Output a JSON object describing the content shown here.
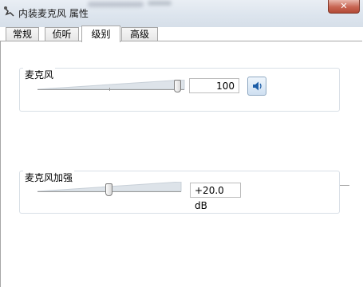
{
  "window": {
    "title": "内装麦克风 属性",
    "app_icon": "microphone-icon",
    "close_glyph": "✕"
  },
  "tabs": [
    {
      "label": "常规",
      "active": false
    },
    {
      "label": "侦听",
      "active": false
    },
    {
      "label": "级别",
      "active": true
    },
    {
      "label": "高级",
      "active": false
    }
  ],
  "microphone": {
    "label": "麦克风",
    "level": 100,
    "value_text": "100",
    "mute_button_icon": "speaker-icon"
  },
  "boost": {
    "label": "麦克风加强",
    "value_text": "+20.0 dB",
    "level_fraction": 0.5
  },
  "colors": {
    "accent": "#1f5fa8",
    "titlebar": "#dde5ee"
  }
}
